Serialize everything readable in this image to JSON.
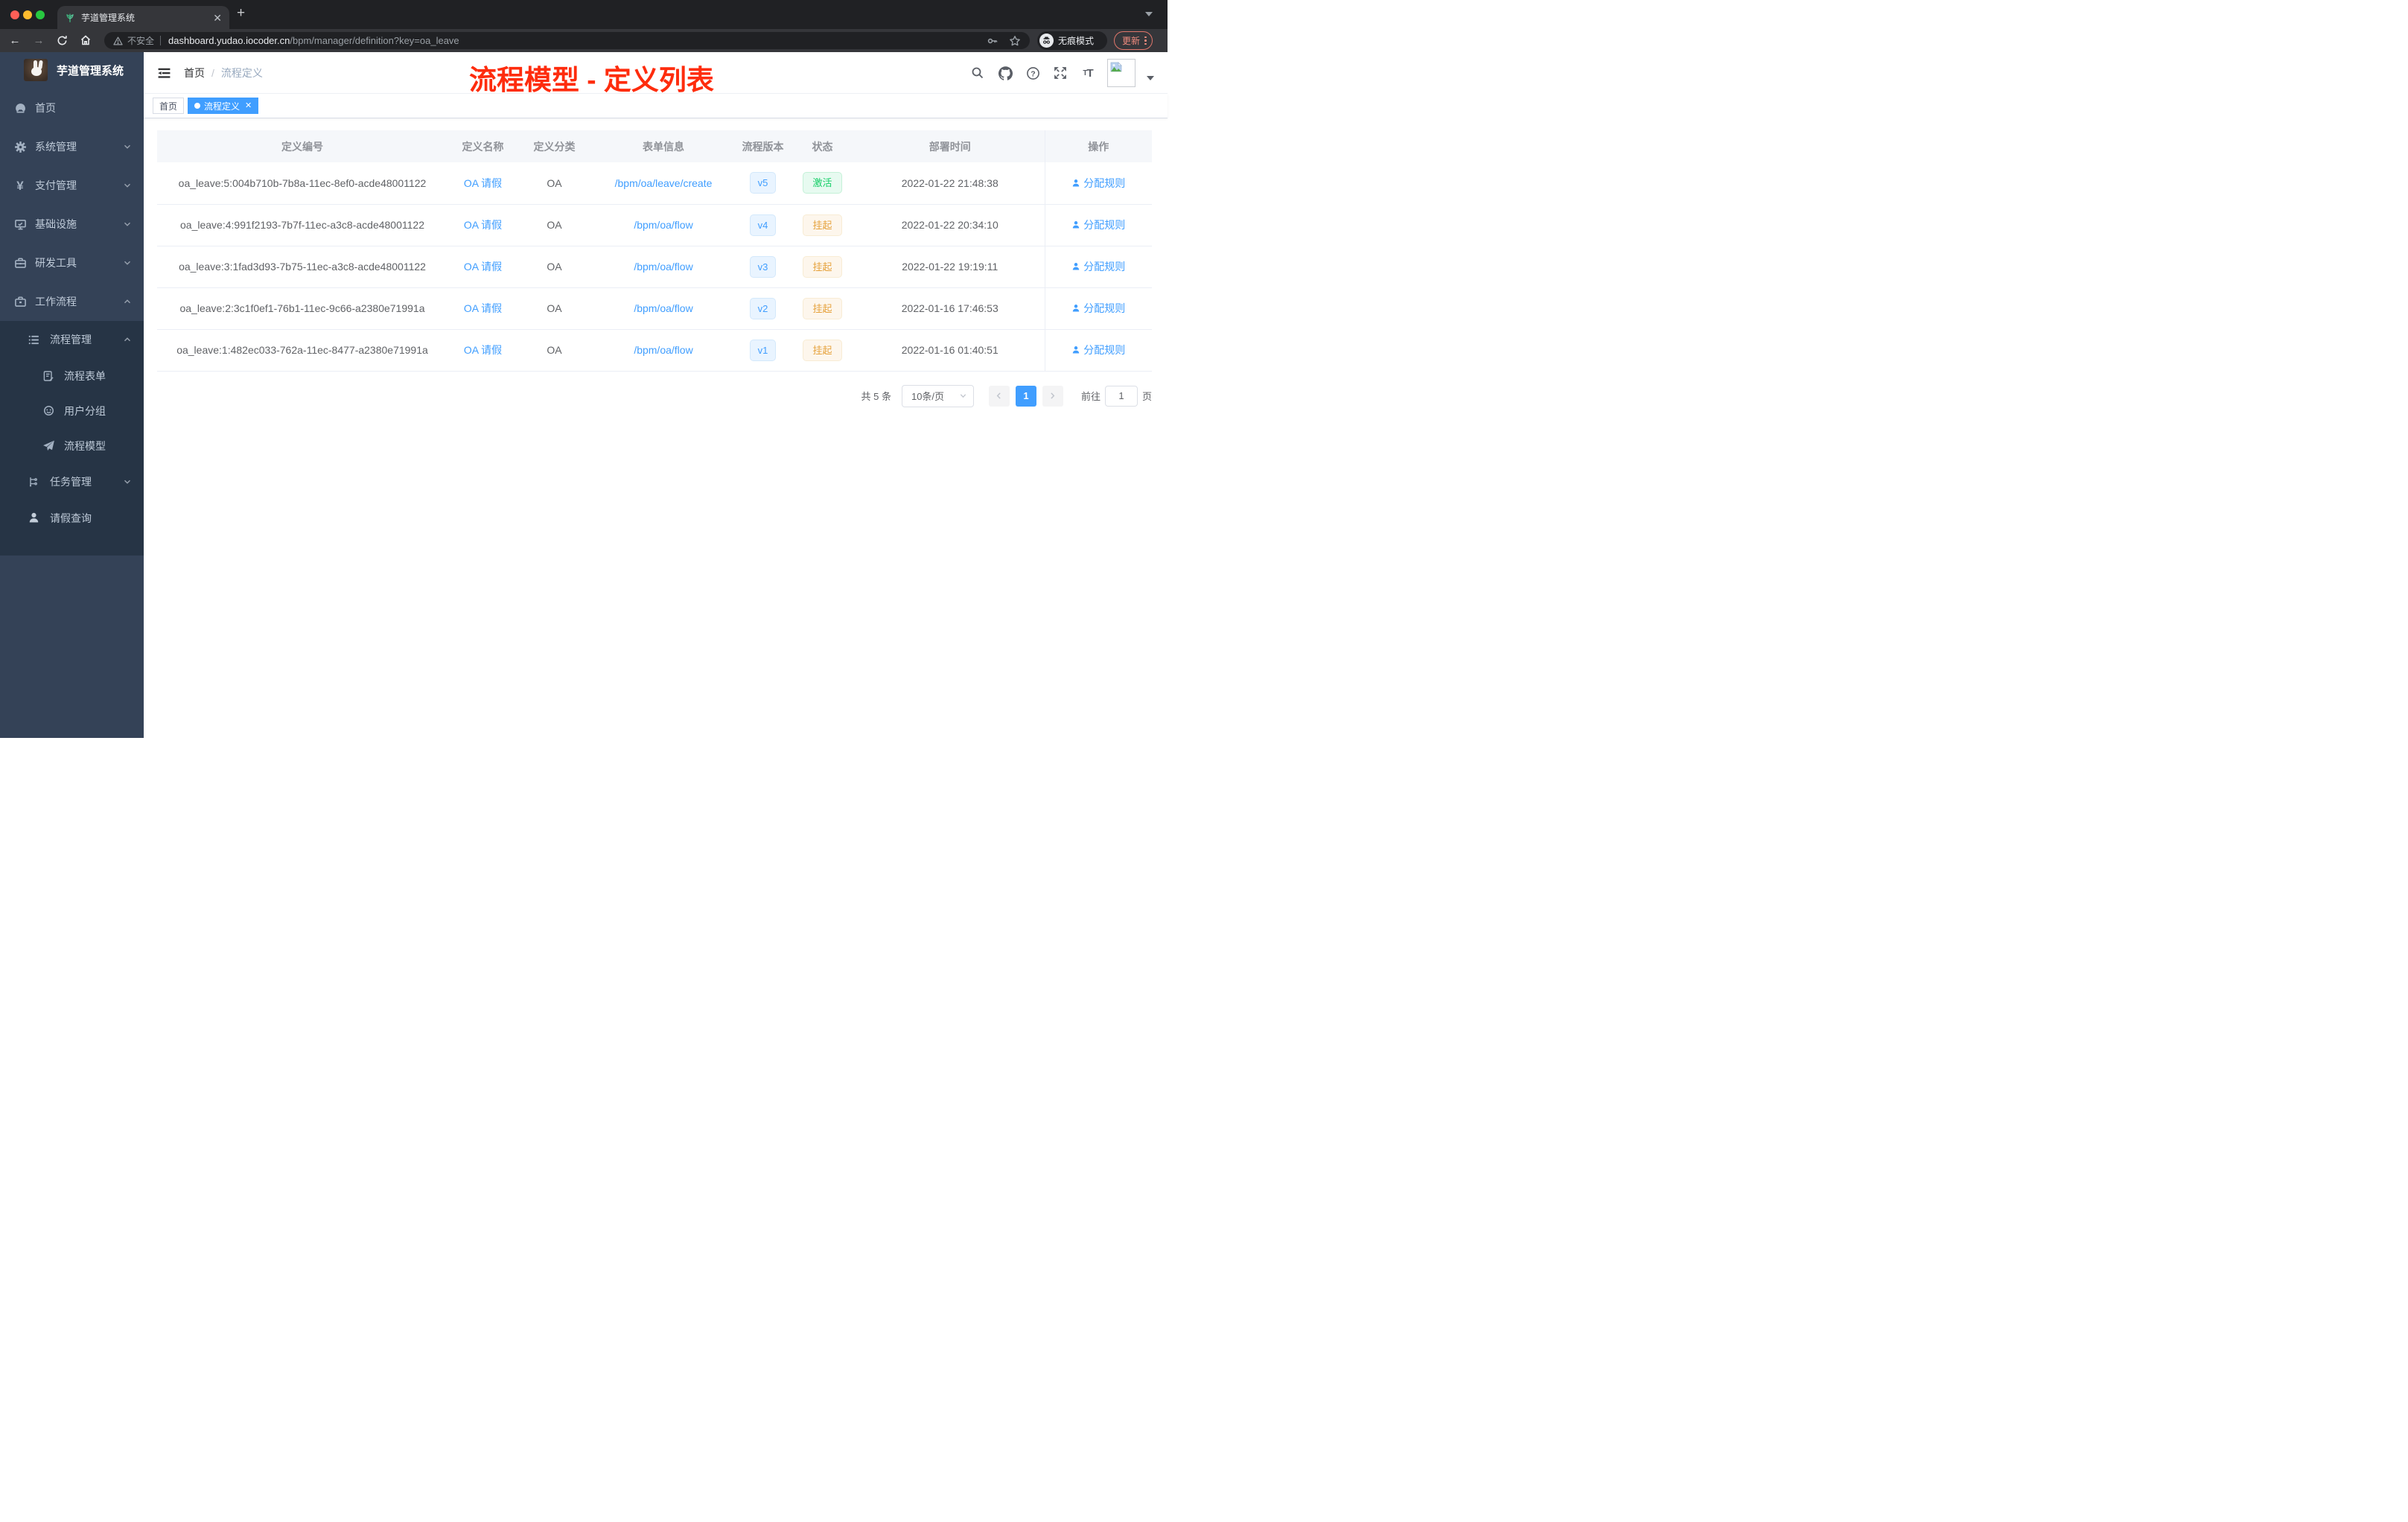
{
  "colors": {
    "primary": "#409eff",
    "annotation_red": "#fe2c0d",
    "status_active_green": "#13ce66",
    "status_suspend_orange": "#e6a23c",
    "sidebar_bg": "#344257",
    "sidebar_sub_bg": "#263445"
  },
  "browser": {
    "tab_title": "芋道管理系统",
    "security_label": "不安全",
    "url_domain": "dashboard.yudao.iocoder.cn",
    "url_path": "/bpm/manager/definition?key=oa_leave",
    "incognito_label": "无痕模式",
    "update_label": "更新"
  },
  "sidebar": {
    "app_title": "芋道管理系统",
    "items": [
      {
        "label": "首页",
        "icon": "dashboard-icon",
        "level": 0,
        "chevron": "none"
      },
      {
        "label": "系统管理",
        "icon": "gear-icon",
        "level": 0,
        "chevron": "down"
      },
      {
        "label": "支付管理",
        "icon": "yen-icon",
        "level": 0,
        "chevron": "down"
      },
      {
        "label": "基础设施",
        "icon": "monitor-icon",
        "level": 0,
        "chevron": "down"
      },
      {
        "label": "研发工具",
        "icon": "toolbox-icon",
        "level": 0,
        "chevron": "down"
      },
      {
        "label": "工作流程",
        "icon": "briefcase-icon",
        "level": 0,
        "chevron": "up"
      },
      {
        "label": "流程管理",
        "icon": "list-icon",
        "level": 1,
        "chevron": "up"
      },
      {
        "label": "流程表单",
        "icon": "form-icon",
        "level": 2,
        "chevron": "none"
      },
      {
        "label": "用户分组",
        "icon": "user-group-icon",
        "level": 2,
        "chevron": "none"
      },
      {
        "label": "流程模型",
        "icon": "paper-plane-icon",
        "level": 2,
        "chevron": "none"
      },
      {
        "label": "任务管理",
        "icon": "tasks-icon",
        "level": 1,
        "chevron": "down"
      },
      {
        "label": "请假查询",
        "icon": "user-icon",
        "level": 1,
        "chevron": "none"
      }
    ]
  },
  "header": {
    "breadcrumb_home": "首页",
    "breadcrumb_current": "流程定义",
    "annotation": "流程模型 - 定义列表"
  },
  "tags": {
    "home": "首页",
    "active": "流程定义"
  },
  "table": {
    "columns": [
      "定义编号",
      "定义名称",
      "定义分类",
      "表单信息",
      "流程版本",
      "状态",
      "部署时间",
      "操作"
    ],
    "rows": [
      {
        "id": "oa_leave:5:004b710b-7b8a-11ec-8ef0-acde48001122",
        "name": "OA 请假",
        "category": "OA",
        "form": "/bpm/oa/leave/create",
        "version": "v5",
        "status": "激活",
        "status_type": "active",
        "time": "2022-01-22 21:48:38",
        "action": "分配规则"
      },
      {
        "id": "oa_leave:4:991f2193-7b7f-11ec-a3c8-acde48001122",
        "name": "OA 请假",
        "category": "OA",
        "form": "/bpm/oa/flow",
        "version": "v4",
        "status": "挂起",
        "status_type": "suspended",
        "time": "2022-01-22 20:34:10",
        "action": "分配规则"
      },
      {
        "id": "oa_leave:3:1fad3d93-7b75-11ec-a3c8-acde48001122",
        "name": "OA 请假",
        "category": "OA",
        "form": "/bpm/oa/flow",
        "version": "v3",
        "status": "挂起",
        "status_type": "suspended",
        "time": "2022-01-22 19:19:11",
        "action": "分配规则"
      },
      {
        "id": "oa_leave:2:3c1f0ef1-76b1-11ec-9c66-a2380e71991a",
        "name": "OA 请假",
        "category": "OA",
        "form": "/bpm/oa/flow",
        "version": "v2",
        "status": "挂起",
        "status_type": "suspended",
        "time": "2022-01-16 17:46:53",
        "action": "分配规则"
      },
      {
        "id": "oa_leave:1:482ec033-762a-11ec-8477-a2380e71991a",
        "name": "OA 请假",
        "category": "OA",
        "form": "/bpm/oa/flow",
        "version": "v1",
        "status": "挂起",
        "status_type": "suspended",
        "time": "2022-01-16 01:40:51",
        "action": "分配规则"
      }
    ]
  },
  "pagination": {
    "total_label": "共 5 条",
    "page_size_label": "10条/页",
    "current_page": "1",
    "goto_label": "前往",
    "goto_value": "1",
    "unit_label": "页"
  }
}
